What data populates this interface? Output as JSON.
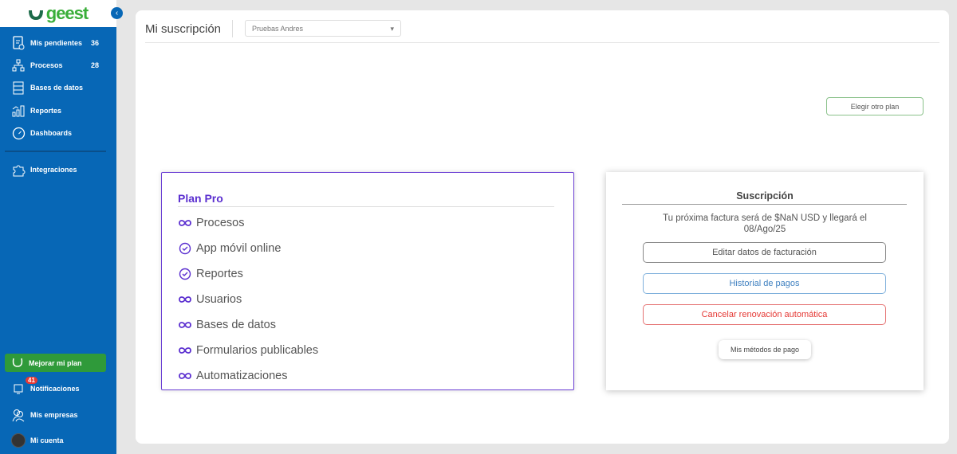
{
  "brand": {
    "name": "geest"
  },
  "sidebar": {
    "items": [
      {
        "label": "Mis pendientes",
        "count": "36",
        "icon": "clipboard-clock-icon"
      },
      {
        "label": "Procesos",
        "count": "28",
        "icon": "sitemap-icon"
      },
      {
        "label": "Bases de datos",
        "icon": "database-icon"
      },
      {
        "label": "Reportes",
        "icon": "chart-icon"
      },
      {
        "label": "Dashboards",
        "icon": "gauge-icon"
      },
      {
        "label": "Integraciones",
        "icon": "puzzle-icon"
      }
    ],
    "upgrade": "Mejorar mi plan",
    "notifications": {
      "label": "Notificaciones",
      "badge": "41"
    },
    "companies": "Mis empresas",
    "account": "Mi cuenta"
  },
  "header": {
    "title": "Mi suscripción",
    "company": "Pruebas Andres"
  },
  "choose_plan": "Elegir otro plan",
  "plan": {
    "title": "Plan Pro",
    "features": [
      {
        "label": "Procesos",
        "icon": "infinity"
      },
      {
        "label": "App móvil online",
        "icon": "check"
      },
      {
        "label": "Reportes",
        "icon": "check"
      },
      {
        "label": "Usuarios",
        "icon": "infinity"
      },
      {
        "label": "Bases de datos",
        "icon": "infinity"
      },
      {
        "label": "Formularios publicables",
        "icon": "infinity"
      },
      {
        "label": "Automatizaciones",
        "icon": "infinity"
      }
    ]
  },
  "subscription": {
    "title": "Suscripción",
    "message": "Tu próxima factura será de $NaN USD y llegará el 08/Ago/25",
    "edit_billing": "Editar datos de facturación",
    "payment_history": "Historial de pagos",
    "cancel_renewal": "Cancelar renovación automática",
    "payment_methods": "Mis métodos de pago"
  },
  "colors": {
    "sidebar": "#0767b6",
    "plan_accent": "#5b2fd0",
    "cancel": "#e53935",
    "history": "#3f80c0",
    "upgrade": "#2f9a3a"
  }
}
